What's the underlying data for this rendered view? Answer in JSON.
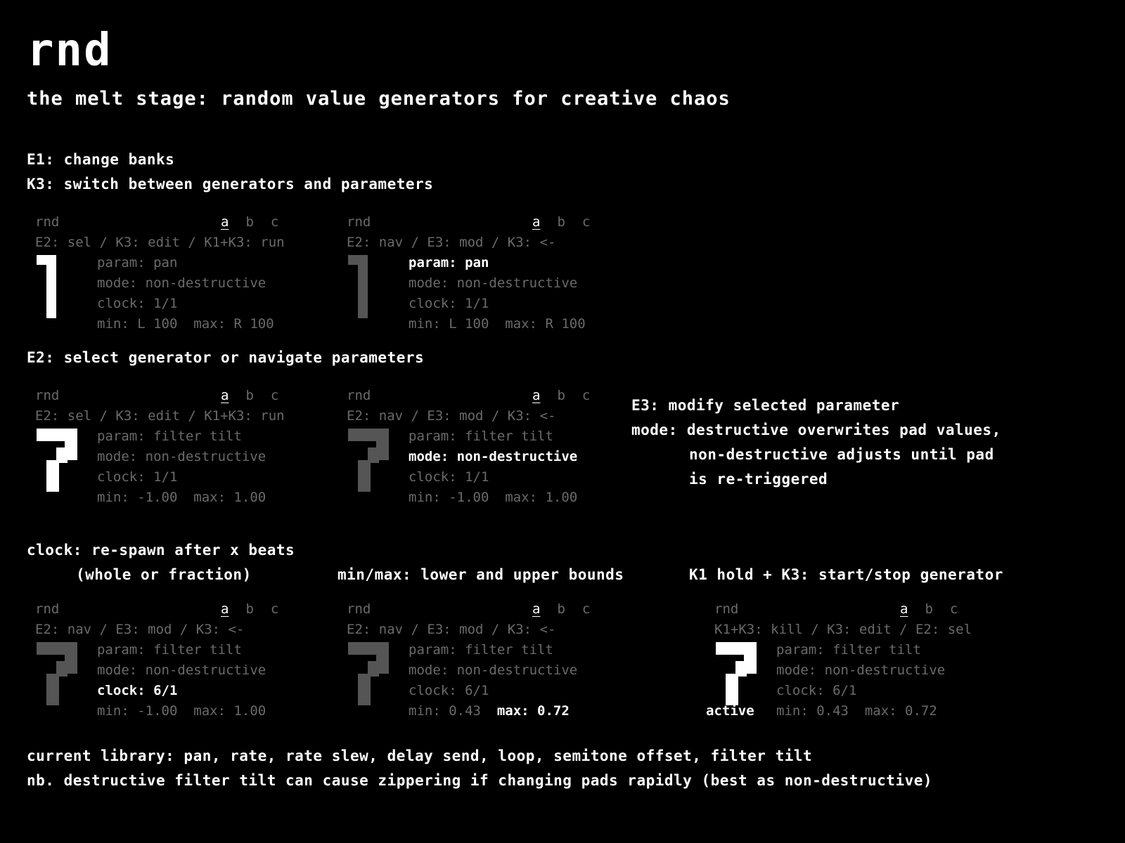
{
  "title": "rnd",
  "subtitle": "the melt stage: random value generators for creative chaos",
  "notes": {
    "e1": "E1: change banks",
    "k3": "K3: switch between generators and parameters",
    "e2": "E2: select generator or navigate parameters",
    "e3": "E3: modify selected parameter",
    "mode1": "mode: destructive overwrites pad values,",
    "mode2": "non-destructive adjusts until pad",
    "mode3": "is re-triggered",
    "clock1": "clock: re-spawn after x beats",
    "clock2": "(whole or fraction)",
    "minmax": "min/max: lower and upper bounds",
    "k1": "K1 hold + K3: start/stop generator",
    "library": "current library: pan, rate, rate slew, delay send, loop, semitone offset, filter tilt",
    "nb": "nb. destructive filter tilt can cause zippering if changing pads rapidly (best as non-destructive)"
  },
  "screen_labels": {
    "name": "rnd",
    "bank_a": "a",
    "bank_b": "b",
    "bank_c": "c",
    "hint_sel": "E2: sel / K3: edit / K1+K3: run",
    "hint_nav": "E2: nav / E3: mod / K3: <-",
    "hint_kill": "K1+K3: kill / K3: edit / E2: sel",
    "active": "active"
  },
  "screens": [
    {
      "hint": "E2: sel / K3: edit / K1+K3: run",
      "digit": "1",
      "digit_color": "#ffffff",
      "param": "param: pan",
      "mode": "mode: non-destructive",
      "clock": "clock: 1/1",
      "min": "min: L 100",
      "max": "max: R 100",
      "highlight": "none"
    },
    {
      "hint": "E2: nav / E3: mod / K3: <-",
      "digit": "1",
      "digit_color": "#555555",
      "param": "param: pan",
      "mode": "mode: non-destructive",
      "clock": "clock: 1/1",
      "min": "min: L 100",
      "max": "max: R 100",
      "highlight": "param"
    },
    {
      "hint": "E2: sel / K3: edit / K1+K3: run",
      "digit": "7",
      "digit_color": "#ffffff",
      "param": "param: filter tilt",
      "mode": "mode: non-destructive",
      "clock": "clock: 1/1",
      "min": "min: -1.00",
      "max": "max: 1.00",
      "highlight": "none"
    },
    {
      "hint": "E2: nav / E3: mod / K3: <-",
      "digit": "7",
      "digit_color": "#555555",
      "param": "param: filter tilt",
      "mode": "mode: non-destructive",
      "clock": "clock: 1/1",
      "min": "min: -1.00",
      "max": "max: 1.00",
      "highlight": "mode"
    },
    {
      "hint": "E2: nav / E3: mod / K3: <-",
      "digit": "7",
      "digit_color": "#555555",
      "param": "param: filter tilt",
      "mode": "mode: non-destructive",
      "clock": "clock: 6/1",
      "min": "min: -1.00",
      "max": "max: 1.00",
      "highlight": "clock"
    },
    {
      "hint": "E2: nav / E3: mod / K3: <-",
      "digit": "7",
      "digit_color": "#555555",
      "param": "param: filter tilt",
      "mode": "mode: non-destructive",
      "clock": "clock: 6/1",
      "min": "min: 0.43",
      "max": "max: 0.72",
      "highlight": "max"
    },
    {
      "hint": "K1+K3: kill / K3: edit / E2: sel",
      "digit": "7",
      "digit_color": "#ffffff",
      "param": "param: filter tilt",
      "mode": "mode: non-destructive",
      "clock": "clock: 6/1",
      "min": "min: 0.43",
      "max": "max: 0.72",
      "highlight": "none",
      "active": true
    }
  ]
}
